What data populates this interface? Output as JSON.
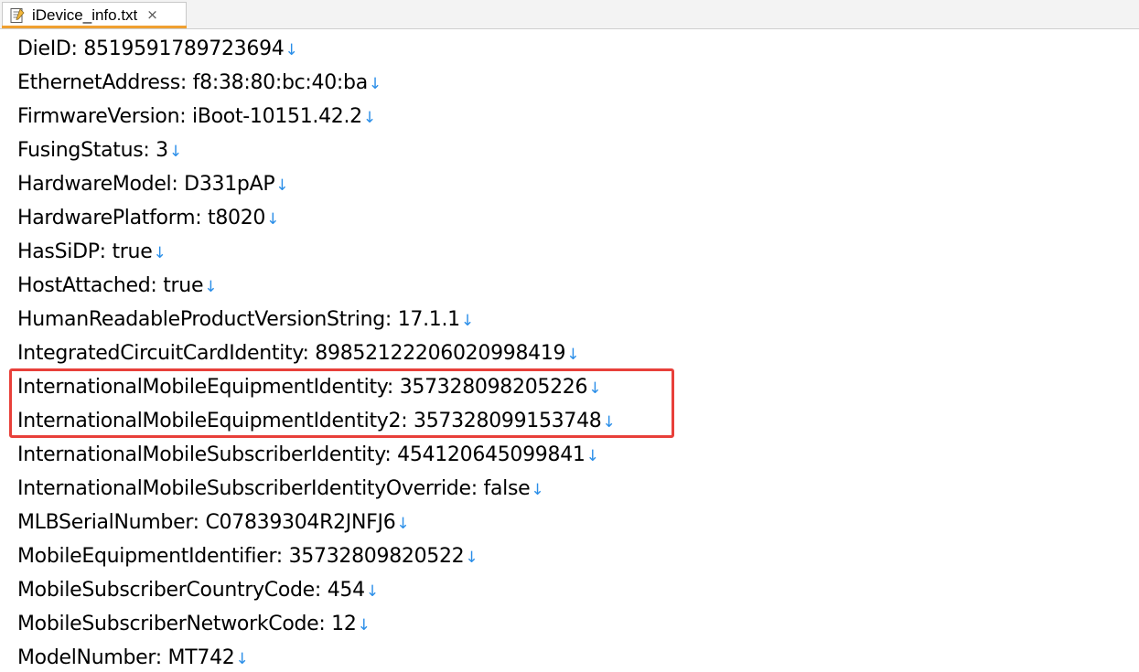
{
  "tab": {
    "title": "iDevice_info.txt",
    "close_glyph": "×",
    "icon": "text-file-icon"
  },
  "eol_glyph": "↓",
  "lines": [
    "DieID: 8519591789723694",
    "EthernetAddress: f8:38:80:bc:40:ba",
    "FirmwareVersion: iBoot-10151.42.2",
    "FusingStatus: 3",
    "HardwareModel: D331pAP",
    "HardwarePlatform: t8020",
    "HasSiDP: true",
    "HostAttached: true",
    "HumanReadableProductVersionString: 17.1.1",
    "IntegratedCircuitCardIdentity: 89852122206020998419",
    "InternationalMobileEquipmentIdentity: 357328098205226",
    "InternationalMobileEquipmentIdentity2: 357328099153748",
    "InternationalMobileSubscriberIdentity: 454120645099841",
    "InternationalMobileSubscriberIdentityOverride: false",
    "MLBSerialNumber: C07839304R2JNFJ6",
    "MobileEquipmentIdentifier: 35732809820522",
    "MobileSubscriberCountryCode: 454",
    "MobileSubscriberNetworkCode: 12",
    "ModelNumber: MT742"
  ],
  "colors": {
    "highlight_border": "#e8403a",
    "eol_marker": "#2a8ee8",
    "tab_accent": "#f0a030"
  }
}
